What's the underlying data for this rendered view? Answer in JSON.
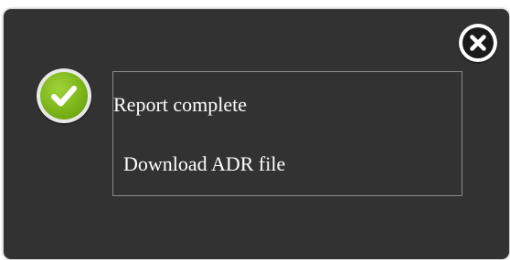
{
  "dialog": {
    "title": "Report complete",
    "download_link_label": "Download ADR file",
    "close_icon": "close-circle-icon",
    "status_icon": "check-circle-icon"
  },
  "colors": {
    "dialog_background": "#323232",
    "success_green": "#7cb518",
    "text": "#ffffff",
    "box_border": "#8a8a8a"
  }
}
